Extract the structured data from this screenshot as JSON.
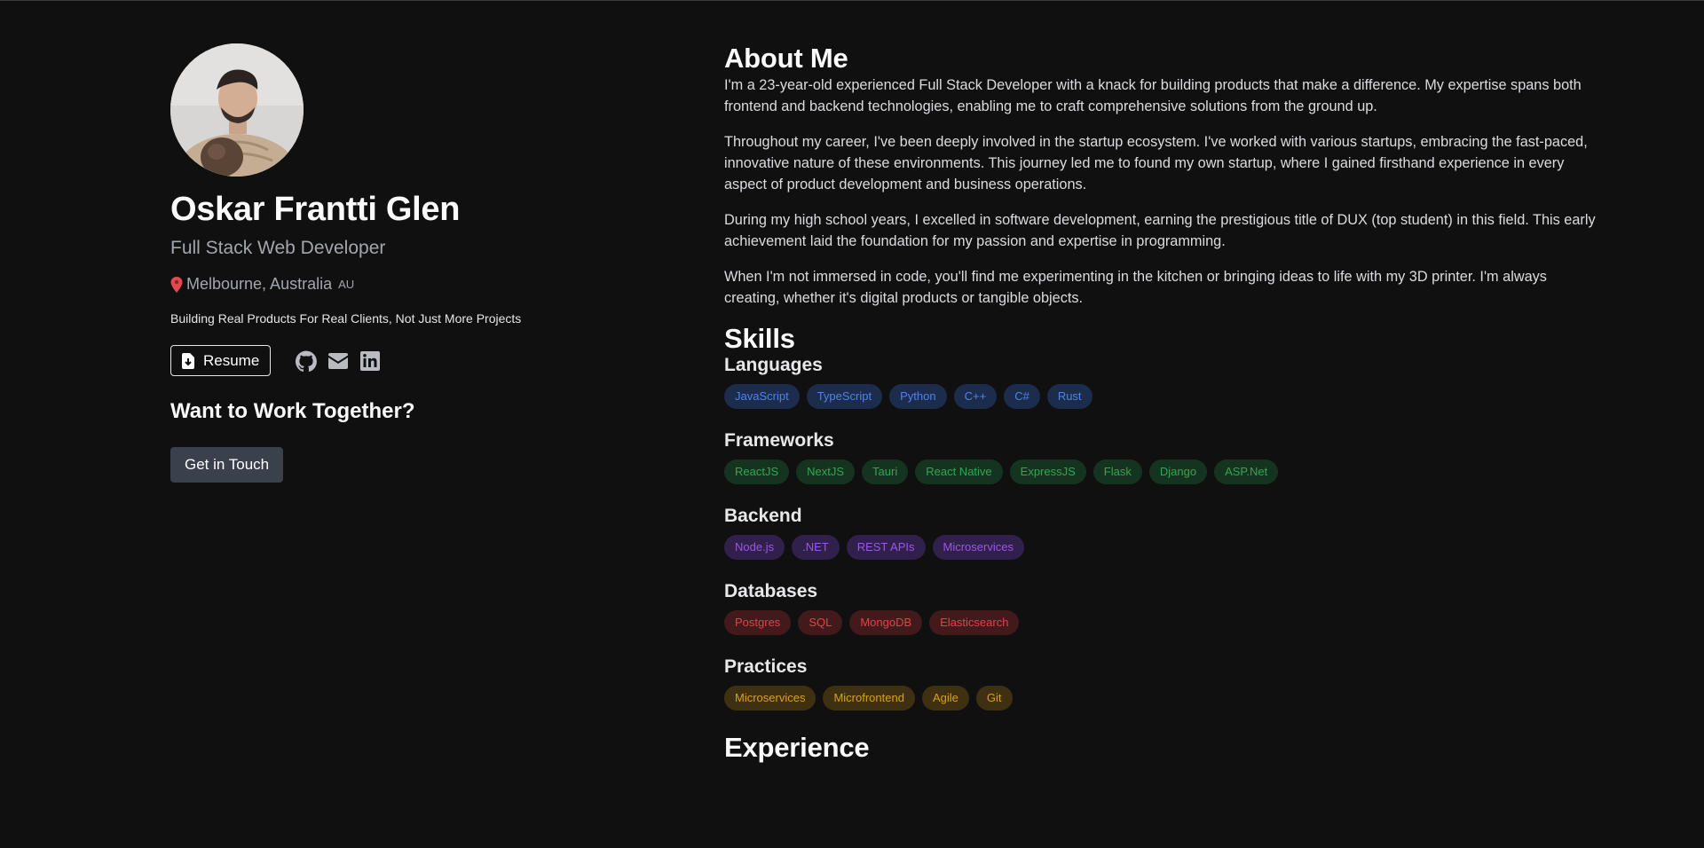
{
  "profile": {
    "name": "Oskar Frantti Glen",
    "role": "Full Stack Web Developer",
    "location": "Melbourne, Australia",
    "country_code": "AU",
    "tagline": "Building Real Products For Real Clients, Not Just More Projects",
    "resume_label": "Resume",
    "cta_title": "Want to Work Together?",
    "cta_button": "Get in Touch",
    "social_icons": [
      "github-icon",
      "mail-icon",
      "linkedin-icon"
    ]
  },
  "about": {
    "title": "About Me",
    "paragraphs": [
      "I'm a 23-year-old experienced Full Stack Developer with a knack for building products that make a difference. My expertise spans both frontend and backend technologies, enabling me to craft comprehensive solutions from the ground up.",
      "Throughout my career, I've been deeply involved in the startup ecosystem. I've worked with various startups, embracing the fast-paced, innovative nature of these environments. This journey led me to found my own startup, where I gained firsthand experience in every aspect of product development and business operations.",
      "During my high school years, I excelled in software development, earning the prestigious title of DUX (top student) in this field. This early achievement laid the foundation for my passion and expertise in programming.",
      "When I'm not immersed in code, you'll find me experimenting in the kitchen or bringing ideas to life with my 3D printer. I'm always creating, whether it's digital products or tangible objects."
    ]
  },
  "skills": {
    "title": "Skills",
    "groups": [
      {
        "name": "Languages",
        "bg": "#1c2c4c",
        "fg": "#4f83e6",
        "items": [
          "JavaScript",
          "TypeScript",
          "Python",
          "C++",
          "C#",
          "Rust"
        ]
      },
      {
        "name": "Frameworks",
        "bg": "#15341f",
        "fg": "#2fa852",
        "items": [
          "ReactJS",
          "NextJS",
          "Tauri",
          "React Native",
          "ExpressJS",
          "Flask",
          "Django",
          "ASP.Net"
        ]
      },
      {
        "name": "Backend",
        "bg": "#31204c",
        "fg": "#9a57e3",
        "items": [
          "Node.js",
          ".NET",
          "REST APIs",
          "Microservices"
        ]
      },
      {
        "name": "Databases",
        "bg": "#421a1c",
        "fg": "#e0434a",
        "items": [
          "Postgres",
          "SQL",
          "MongoDB",
          "Elasticsearch"
        ]
      },
      {
        "name": "Practices",
        "bg": "#3f3012",
        "fg": "#d9a118",
        "items": [
          "Microservices",
          "Microfrontend",
          "Agile",
          "Git"
        ]
      }
    ]
  },
  "experience": {
    "title": "Experience"
  }
}
